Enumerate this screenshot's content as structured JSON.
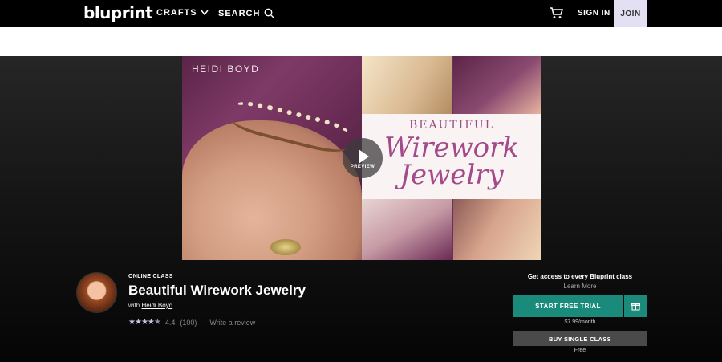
{
  "nav": {
    "logo": "bluprint",
    "crafts": "CRAFTS",
    "search": "SEARCH",
    "sign_in": "SIGN IN",
    "join": "JOIN",
    "icons": [
      "chevron-down-icon",
      "search-icon",
      "cart-icon"
    ]
  },
  "video": {
    "author_tag": "HEIDI BOYD",
    "title_line1": "BEAUTIFUL",
    "title_line2": "Wirework",
    "title_line3": "Jewelry",
    "play_label": "PREVIEW"
  },
  "class": {
    "kind": "ONLINE CLASS",
    "title": "Beautiful Wirework Jewelry",
    "with_prefix": "with",
    "instructor": "Heidi Boyd",
    "rating": "4.4",
    "rating_count": "(100)",
    "stars_filled": 4.4,
    "write_review": "Write a review"
  },
  "cta": {
    "heading": "Get access to every Bluprint class",
    "learn_more": "Learn More",
    "trial_button": "START FREE TRIAL",
    "price": "$7.99/month",
    "single_button": "BUY SINGLE CLASS",
    "single_sub": "Free",
    "accent_color": "#1a8a7b"
  }
}
